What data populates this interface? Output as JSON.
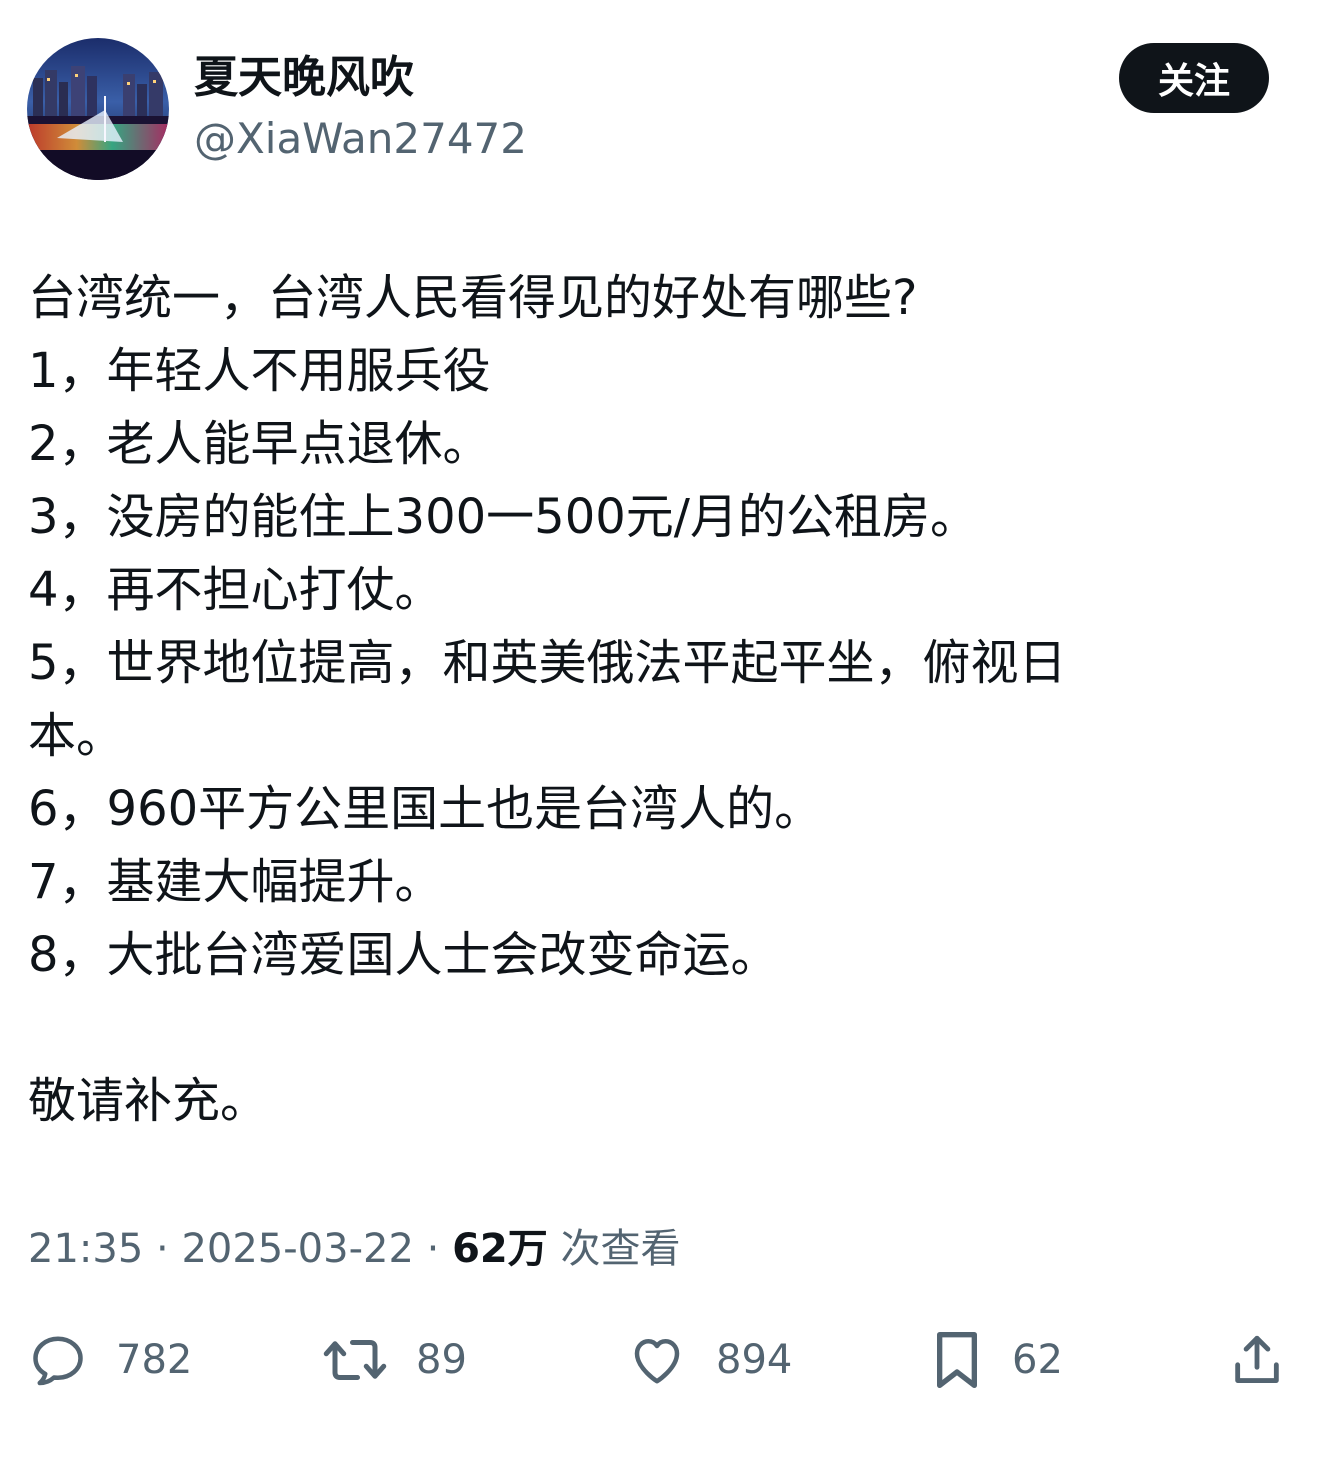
{
  "author": {
    "display_name": "夏天晚风吹",
    "handle": "@XiaWan27472",
    "avatar_description": "night-city-avatar"
  },
  "follow_button": {
    "label": "关注"
  },
  "tweet": {
    "lines": [
      "台湾统一，台湾人民看得见的好处有哪些?",
      "1，年轻人不用服兵役",
      "2，老人能早点退休。",
      "3，没房的能住上300一500元/月的公租房。",
      "4，再不担心打仗。",
      "5，世界地位提高，和英美俄法平起平坐，俯视日",
      "本。",
      "6，960平方公里国土也是台湾人的。",
      "7，基建大幅提升。",
      "8，大批台湾爱国人士会改变命运。",
      "",
      "敬请补充。"
    ]
  },
  "meta": {
    "time": "21:35",
    "separator": " · ",
    "date": "2025-03-22",
    "views_count": "62万",
    "views_label": "次查看"
  },
  "actions": {
    "reply": {
      "icon": "reply-icon",
      "count": "782"
    },
    "retweet": {
      "icon": "retweet-icon",
      "count": "89"
    },
    "like": {
      "icon": "heart-icon",
      "count": "894"
    },
    "bookmark": {
      "icon": "bookmark-icon",
      "count": "62"
    },
    "share": {
      "icon": "share-icon"
    }
  },
  "colors": {
    "text_primary": "#0f1419",
    "text_secondary": "#536471",
    "button_bg": "#0f1419",
    "background": "#ffffff"
  }
}
